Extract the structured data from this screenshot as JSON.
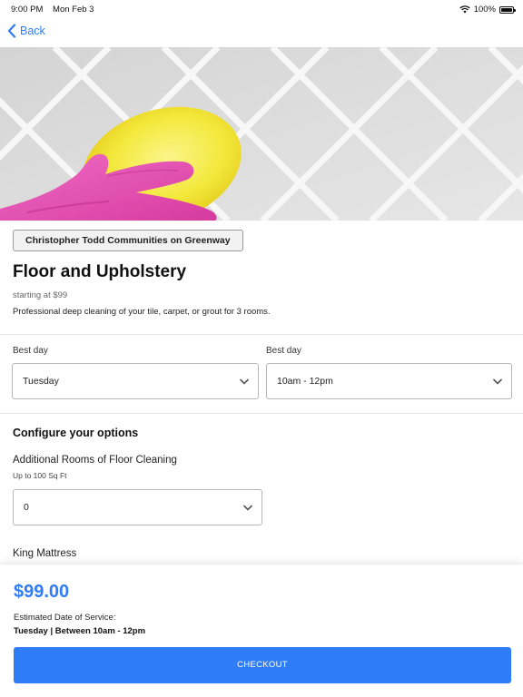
{
  "status_bar": {
    "time": "9:00 PM",
    "date": "Mon Feb 3",
    "battery": "100%",
    "battery_level": 1.0
  },
  "nav": {
    "back_label": "Back",
    "accent_color": "#2f7cf6"
  },
  "hero": {
    "icon": "cleaning-photo"
  },
  "service": {
    "community": "Christopher Todd Communities on Greenway",
    "title": "Floor and Upholstery",
    "starting_price": "starting at $99",
    "description": "Professional deep cleaning of your tile, carpet, or grout for 3 rooms."
  },
  "schedule": {
    "day_label": "Best day",
    "day_value": "Tuesday",
    "time_label": "Best day",
    "time_value": "10am - 12pm"
  },
  "options": {
    "section_title": "Configure your options",
    "items": [
      {
        "label": "Additional Rooms of Floor Cleaning",
        "sublabel": "Up to 100 Sq Ft",
        "value": "0"
      },
      {
        "label": "King Mattress"
      }
    ]
  },
  "footer": {
    "total": "$99.00",
    "estimated_label": "Estimated Date of Service:",
    "estimated_value": "Tuesday | Between 10am - 12pm",
    "checkout_label": "CHECKOUT"
  }
}
